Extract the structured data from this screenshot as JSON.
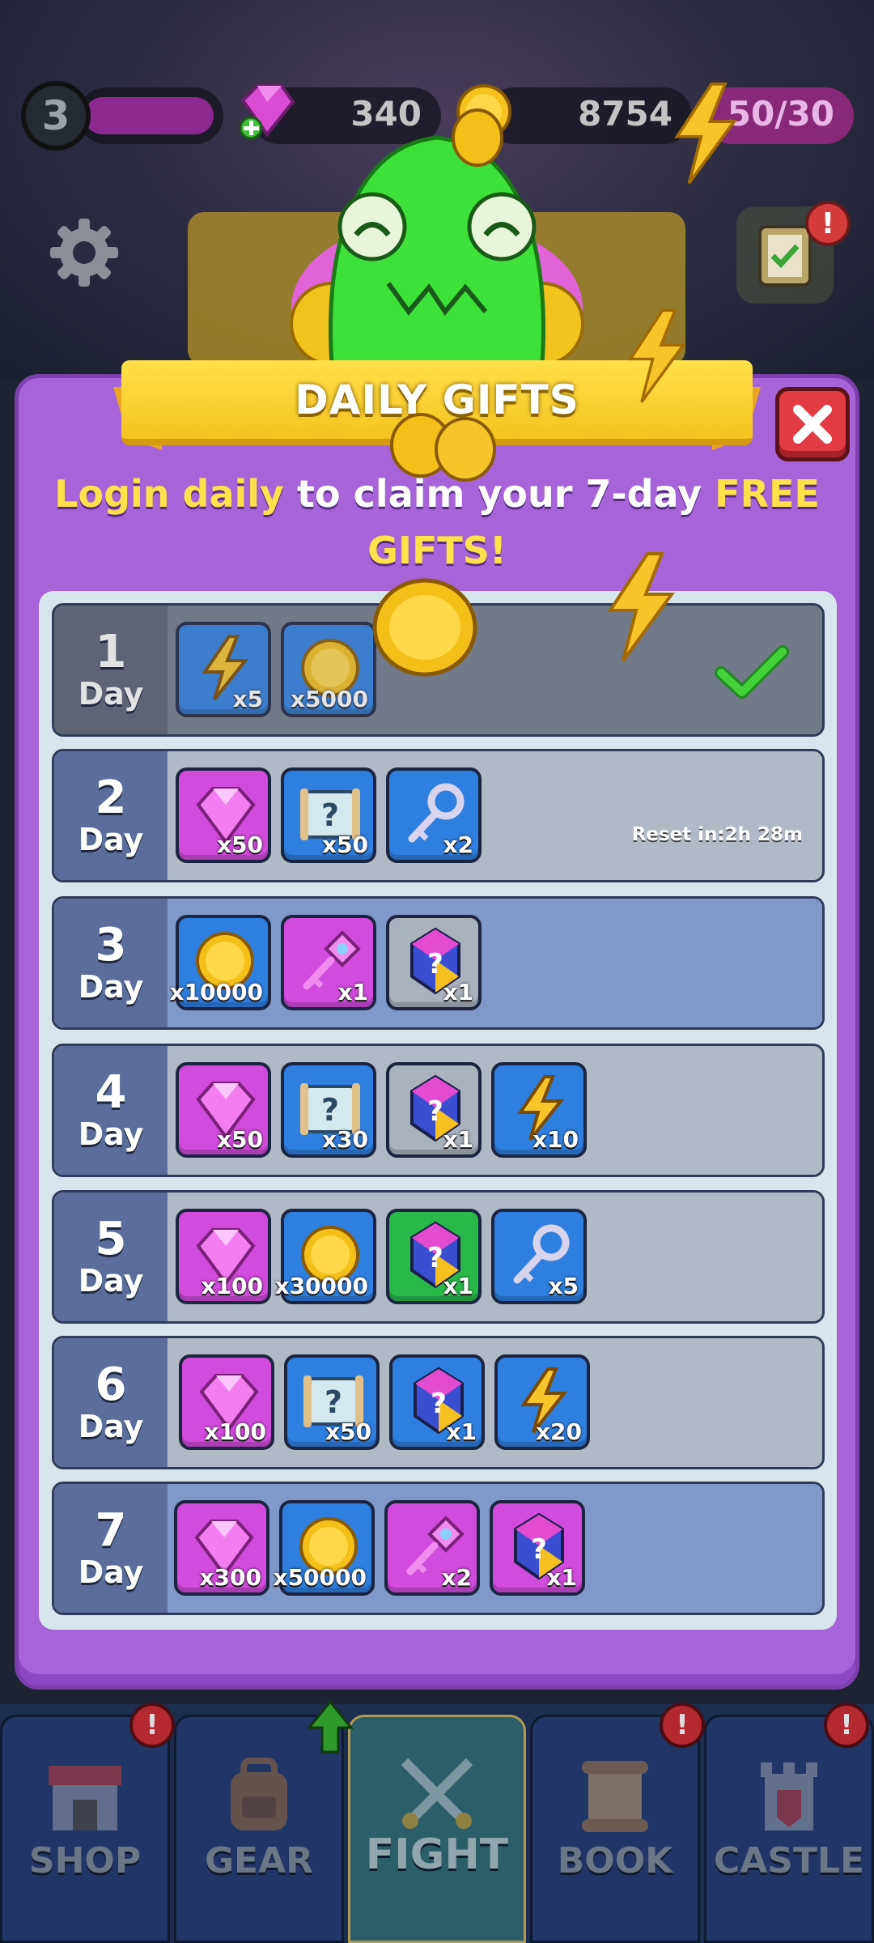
{
  "hud": {
    "level": "3",
    "gems": "340",
    "coins": "8754",
    "energy": "50/30"
  },
  "dialog": {
    "title": "DAILY GIFTS",
    "subtitle_part1": "Login daily",
    "subtitle_part2": " to claim your 7-day ",
    "subtitle_part3": "FREE GIFTS!",
    "reset_text": "Reset in:2h 28m"
  },
  "day_label": "Day",
  "days": [
    {
      "num": "1",
      "items": [
        {
          "icon": "energy-bolt-icon",
          "qty": "x5"
        },
        {
          "icon": "gold-coin-icon",
          "qty": "x5000"
        }
      ]
    },
    {
      "num": "2",
      "items": [
        {
          "icon": "gem-icon",
          "qty": "x50"
        },
        {
          "icon": "mystery-scroll-icon",
          "qty": "x50"
        },
        {
          "icon": "silver-key-icon",
          "qty": "x2"
        }
      ]
    },
    {
      "num": "3",
      "items": [
        {
          "icon": "gold-coin-icon",
          "qty": "x10000"
        },
        {
          "icon": "pink-key-icon",
          "qty": "x1"
        },
        {
          "icon": "mystery-crystal-icon",
          "qty": "x1"
        }
      ]
    },
    {
      "num": "4",
      "items": [
        {
          "icon": "gem-icon",
          "qty": "x50"
        },
        {
          "icon": "mystery-scroll-icon",
          "qty": "x30"
        },
        {
          "icon": "mystery-crystal-icon",
          "qty": "x1"
        },
        {
          "icon": "energy-bolt-icon",
          "qty": "x10"
        }
      ]
    },
    {
      "num": "5",
      "items": [
        {
          "icon": "gem-icon",
          "qty": "x100"
        },
        {
          "icon": "gold-coin-icon",
          "qty": "x30000"
        },
        {
          "icon": "mystery-crystal-icon",
          "qty": "x1"
        },
        {
          "icon": "silver-key-icon",
          "qty": "x5"
        }
      ]
    },
    {
      "num": "6",
      "items": [
        {
          "icon": "gem-icon",
          "qty": "x100"
        },
        {
          "icon": "mystery-scroll-icon",
          "qty": "x50"
        },
        {
          "icon": "mystery-crystal-icon",
          "qty": "x1"
        },
        {
          "icon": "energy-bolt-icon",
          "qty": "x20"
        }
      ]
    },
    {
      "num": "7",
      "items": [
        {
          "icon": "gem-icon",
          "qty": "x300"
        },
        {
          "icon": "gold-coin-icon",
          "qty": "x50000"
        },
        {
          "icon": "pink-key-icon",
          "qty": "x2"
        },
        {
          "icon": "mystery-crystal-icon",
          "qty": "x1"
        }
      ]
    }
  ],
  "nav": {
    "shop": "SHOP",
    "gear": "GEAR",
    "fight": "FIGHT",
    "book": "BOOK",
    "castle": "CASTLE",
    "badge": "!"
  }
}
